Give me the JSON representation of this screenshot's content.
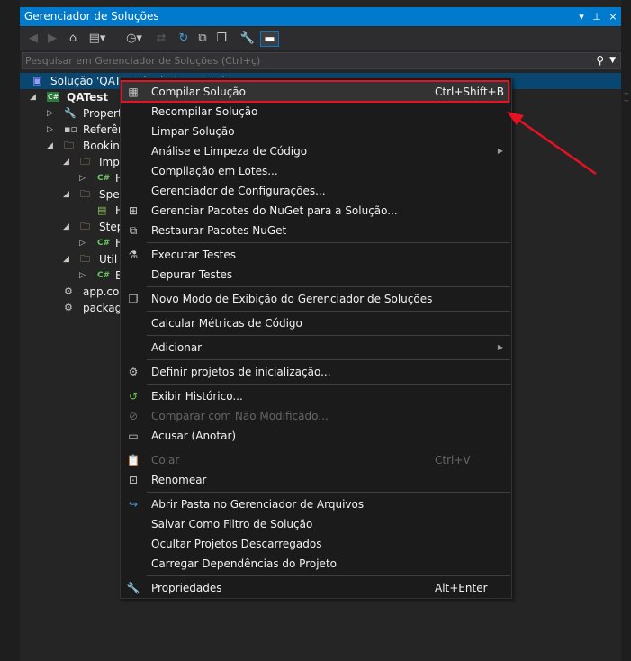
{
  "window": {
    "title": "Gerenciador de Soluções",
    "buttons": [
      "▾",
      "⊥",
      "×"
    ]
  },
  "search": {
    "placeholder": "Pesquisar em Gerenciador de Soluções (Ctrl+ç)"
  },
  "tree": [
    {
      "label": "Solução 'QATest' (1 de 1 projeto)",
      "icon": "solution-icon",
      "selected": true
    },
    {
      "label": "QATest",
      "icon": "csharp-project-icon",
      "bold": true
    },
    {
      "label": "Properties",
      "icon": "wrench-icon"
    },
    {
      "label": "Referências",
      "icon": "references-icon"
    },
    {
      "label": "Booking",
      "icon": "folder-icon"
    },
    {
      "label": "Imp",
      "icon": "folder-icon"
    },
    {
      "label": "H",
      "icon": "csharp-file-icon"
    },
    {
      "label": "Spec",
      "icon": "folder-icon"
    },
    {
      "label": "H",
      "icon": "feature-file-icon"
    },
    {
      "label": "Step",
      "icon": "folder-icon"
    },
    {
      "label": "H",
      "icon": "csharp-file-icon"
    },
    {
      "label": "Util",
      "icon": "folder-icon"
    },
    {
      "label": "E",
      "icon": "csharp-file-icon"
    },
    {
      "label": "app.config",
      "icon": "config-file-icon"
    },
    {
      "label": "packages.config",
      "icon": "config-file-icon"
    }
  ],
  "menu": {
    "items": [
      {
        "label": "Compilar Solução",
        "shortcut": "Ctrl+Shift+B",
        "icon": "build-icon"
      },
      {
        "label": "Recompilar Solução"
      },
      {
        "label": "Limpar Solução"
      },
      {
        "label": "Análise e Limpeza de Código",
        "submenu": true
      },
      {
        "label": "Compilação em Lotes..."
      },
      {
        "label": "Gerenciador de Configurações..."
      },
      {
        "label": "Gerenciar Pacotes do NuGet para a Solução...",
        "icon": "nuget-icon"
      },
      {
        "label": "Restaurar Pacotes NuGet",
        "icon": "restore-icon"
      },
      {
        "label": "Executar Testes",
        "icon": "flask-icon"
      },
      {
        "label": "Depurar Testes"
      },
      {
        "label": "Novo Modo de Exibição do Gerenciador de Soluções",
        "icon": "new-view-icon"
      },
      {
        "label": "Calcular Métricas de Código"
      },
      {
        "label": "Adicionar",
        "submenu": true
      },
      {
        "label": "Definir projetos de inicialização...",
        "icon": "gear-icon"
      },
      {
        "label": "Exibir Histórico...",
        "icon": "history-icon"
      },
      {
        "label": "Comparar com Não Modificado...",
        "icon": "compare-icon",
        "disabled": true
      },
      {
        "label": "Acusar (Anotar)",
        "icon": "annotate-icon"
      },
      {
        "label": "Colar",
        "shortcut": "Ctrl+V",
        "icon": "paste-icon",
        "disabled": true
      },
      {
        "label": "Renomear",
        "icon": "rename-icon"
      },
      {
        "label": "Abrir Pasta no Gerenciador de Arquivos",
        "icon": "open-folder-icon"
      },
      {
        "label": "Salvar Como Filtro de Solução"
      },
      {
        "label": "Ocultar Projetos Descarregados"
      },
      {
        "label": "Carregar Dependências do Projeto"
      },
      {
        "label": "Propriedades",
        "shortcut": "Alt+Enter",
        "icon": "wrench-icon"
      }
    ]
  },
  "colors": {
    "accent": "#007acc",
    "callout": "#e81123",
    "menu_bg": "#1b1b1c",
    "panel_bg": "#252526"
  }
}
